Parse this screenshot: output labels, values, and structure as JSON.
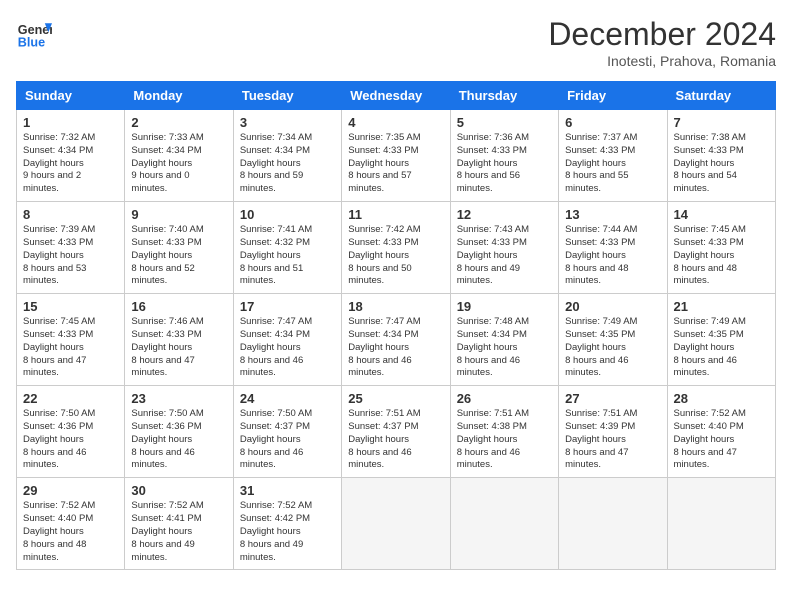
{
  "header": {
    "logo_line1": "General",
    "logo_line2": "Blue",
    "month": "December 2024",
    "location": "Inotesti, Prahova, Romania"
  },
  "weekdays": [
    "Sunday",
    "Monday",
    "Tuesday",
    "Wednesday",
    "Thursday",
    "Friday",
    "Saturday"
  ],
  "weeks": [
    [
      {
        "day": 1,
        "sunrise": "7:32 AM",
        "sunset": "4:34 PM",
        "daylight": "9 hours and 2 minutes."
      },
      {
        "day": 2,
        "sunrise": "7:33 AM",
        "sunset": "4:34 PM",
        "daylight": "9 hours and 0 minutes."
      },
      {
        "day": 3,
        "sunrise": "7:34 AM",
        "sunset": "4:34 PM",
        "daylight": "8 hours and 59 minutes."
      },
      {
        "day": 4,
        "sunrise": "7:35 AM",
        "sunset": "4:33 PM",
        "daylight": "8 hours and 57 minutes."
      },
      {
        "day": 5,
        "sunrise": "7:36 AM",
        "sunset": "4:33 PM",
        "daylight": "8 hours and 56 minutes."
      },
      {
        "day": 6,
        "sunrise": "7:37 AM",
        "sunset": "4:33 PM",
        "daylight": "8 hours and 55 minutes."
      },
      {
        "day": 7,
        "sunrise": "7:38 AM",
        "sunset": "4:33 PM",
        "daylight": "8 hours and 54 minutes."
      }
    ],
    [
      {
        "day": 8,
        "sunrise": "7:39 AM",
        "sunset": "4:33 PM",
        "daylight": "8 hours and 53 minutes."
      },
      {
        "day": 9,
        "sunrise": "7:40 AM",
        "sunset": "4:33 PM",
        "daylight": "8 hours and 52 minutes."
      },
      {
        "day": 10,
        "sunrise": "7:41 AM",
        "sunset": "4:32 PM",
        "daylight": "8 hours and 51 minutes."
      },
      {
        "day": 11,
        "sunrise": "7:42 AM",
        "sunset": "4:33 PM",
        "daylight": "8 hours and 50 minutes."
      },
      {
        "day": 12,
        "sunrise": "7:43 AM",
        "sunset": "4:33 PM",
        "daylight": "8 hours and 49 minutes."
      },
      {
        "day": 13,
        "sunrise": "7:44 AM",
        "sunset": "4:33 PM",
        "daylight": "8 hours and 48 minutes."
      },
      {
        "day": 14,
        "sunrise": "7:45 AM",
        "sunset": "4:33 PM",
        "daylight": "8 hours and 48 minutes."
      }
    ],
    [
      {
        "day": 15,
        "sunrise": "7:45 AM",
        "sunset": "4:33 PM",
        "daylight": "8 hours and 47 minutes."
      },
      {
        "day": 16,
        "sunrise": "7:46 AM",
        "sunset": "4:33 PM",
        "daylight": "8 hours and 47 minutes."
      },
      {
        "day": 17,
        "sunrise": "7:47 AM",
        "sunset": "4:34 PM",
        "daylight": "8 hours and 46 minutes."
      },
      {
        "day": 18,
        "sunrise": "7:47 AM",
        "sunset": "4:34 PM",
        "daylight": "8 hours and 46 minutes."
      },
      {
        "day": 19,
        "sunrise": "7:48 AM",
        "sunset": "4:34 PM",
        "daylight": "8 hours and 46 minutes."
      },
      {
        "day": 20,
        "sunrise": "7:49 AM",
        "sunset": "4:35 PM",
        "daylight": "8 hours and 46 minutes."
      },
      {
        "day": 21,
        "sunrise": "7:49 AM",
        "sunset": "4:35 PM",
        "daylight": "8 hours and 46 minutes."
      }
    ],
    [
      {
        "day": 22,
        "sunrise": "7:50 AM",
        "sunset": "4:36 PM",
        "daylight": "8 hours and 46 minutes."
      },
      {
        "day": 23,
        "sunrise": "7:50 AM",
        "sunset": "4:36 PM",
        "daylight": "8 hours and 46 minutes."
      },
      {
        "day": 24,
        "sunrise": "7:50 AM",
        "sunset": "4:37 PM",
        "daylight": "8 hours and 46 minutes."
      },
      {
        "day": 25,
        "sunrise": "7:51 AM",
        "sunset": "4:37 PM",
        "daylight": "8 hours and 46 minutes."
      },
      {
        "day": 26,
        "sunrise": "7:51 AM",
        "sunset": "4:38 PM",
        "daylight": "8 hours and 46 minutes."
      },
      {
        "day": 27,
        "sunrise": "7:51 AM",
        "sunset": "4:39 PM",
        "daylight": "8 hours and 47 minutes."
      },
      {
        "day": 28,
        "sunrise": "7:52 AM",
        "sunset": "4:40 PM",
        "daylight": "8 hours and 47 minutes."
      }
    ],
    [
      {
        "day": 29,
        "sunrise": "7:52 AM",
        "sunset": "4:40 PM",
        "daylight": "8 hours and 48 minutes."
      },
      {
        "day": 30,
        "sunrise": "7:52 AM",
        "sunset": "4:41 PM",
        "daylight": "8 hours and 49 minutes."
      },
      {
        "day": 31,
        "sunrise": "7:52 AM",
        "sunset": "4:42 PM",
        "daylight": "8 hours and 49 minutes."
      },
      null,
      null,
      null,
      null
    ]
  ]
}
